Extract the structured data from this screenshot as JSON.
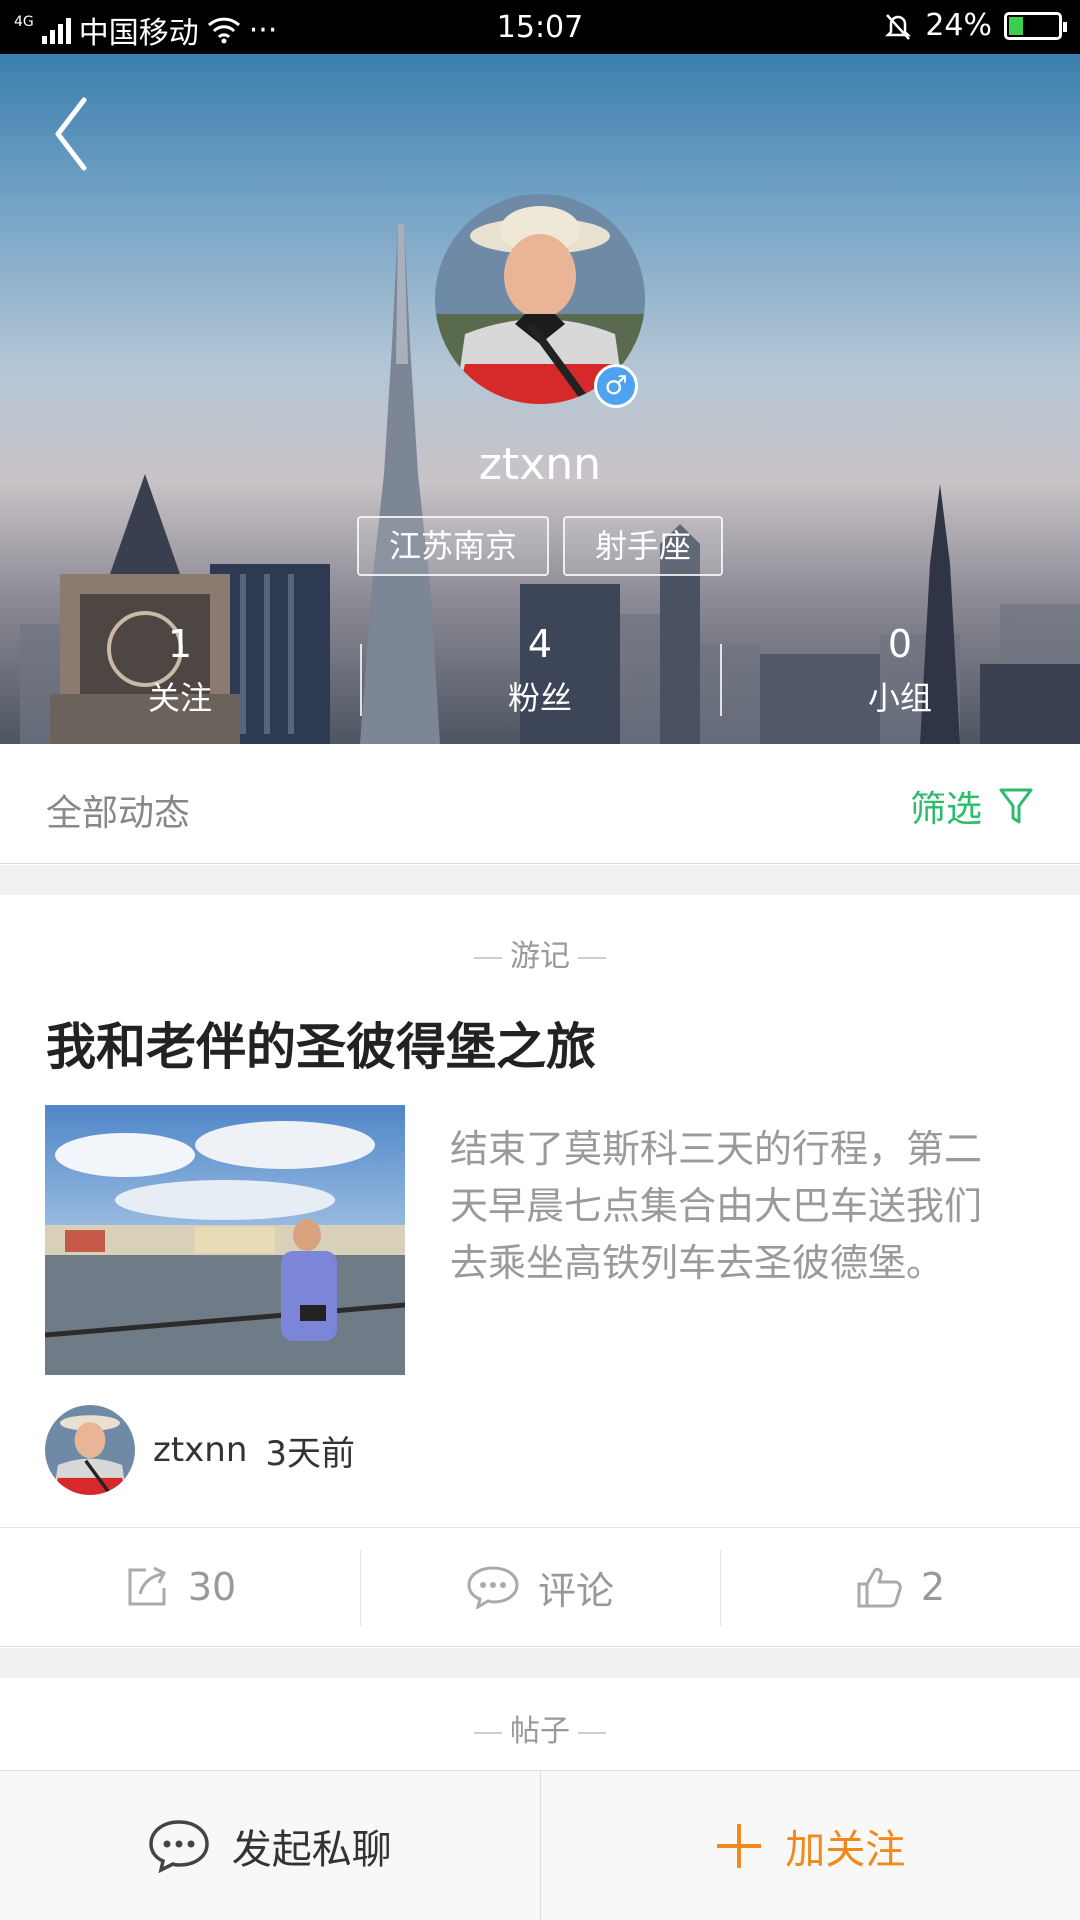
{
  "status_bar": {
    "network": "4G",
    "carrier": "中国移动",
    "more": "···",
    "time": "15:07",
    "battery": "24%",
    "battery_level": 0.24
  },
  "profile": {
    "username": "ztxnn",
    "gender_symbol": "♂",
    "tags": [
      "江苏南京",
      "射手座"
    ],
    "stats": [
      {
        "value": "1",
        "label": "关注"
      },
      {
        "value": "4",
        "label": "粉丝"
      },
      {
        "value": "0",
        "label": "小组"
      }
    ]
  },
  "feed": {
    "all_label": "全部动态",
    "filter_label": "筛选",
    "accent_color": "#2bbd6b"
  },
  "post": {
    "category": "游记",
    "title": "我和老伴的圣彼得堡之旅",
    "excerpt": "结束了莫斯科三天的行程，第二天早晨七点集合由大巴车送我们去乘坐高铁列车去圣彼德堡。",
    "author": "ztxnn",
    "time_ago": "3天前",
    "shares": "30",
    "comment_label": "评论",
    "likes": "2"
  },
  "next_post": {
    "category": "帖子"
  },
  "bottom_bar": {
    "chat_label": "发起私聊",
    "follow_label": "加关注",
    "follow_color": "#f08a1c"
  }
}
